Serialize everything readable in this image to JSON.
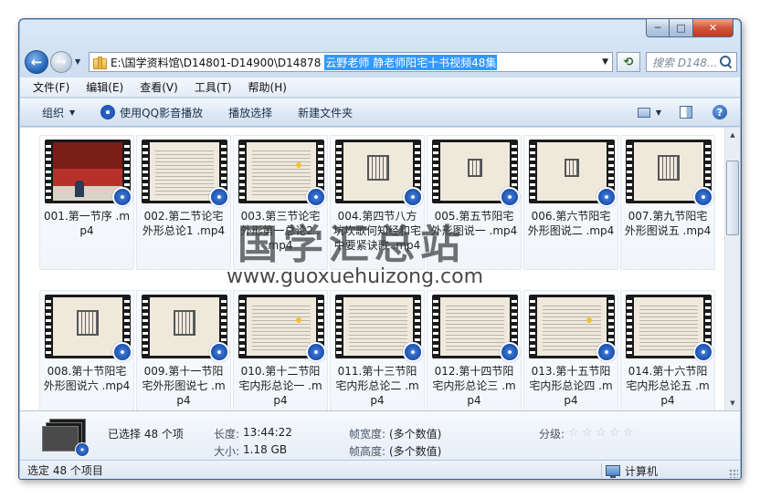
{
  "window": {
    "caption_buttons": {
      "minimize": "─",
      "maximize": "□",
      "close": "✕"
    }
  },
  "address": {
    "path_prefix": "E:\\国学资料馆\\D14801-D14900\\D14878",
    "path_selected": "云野老师 静老师阳宅十书视频48集",
    "search_placeholder": "搜索 D148..."
  },
  "menu": [
    "文件(F)",
    "编辑(E)",
    "查看(V)",
    "工具(T)",
    "帮助(H)"
  ],
  "toolbar": {
    "organize": "组织",
    "play_qq": "使用QQ影音播放",
    "play_selection": "播放选择",
    "new_folder": "新建文件夹"
  },
  "files": [
    {
      "label": "001.第一节序 .mp4",
      "thumb": "photo"
    },
    {
      "label": "002.第二节论宅外形总论1 .mp4",
      "thumb": "text"
    },
    {
      "label": "003.第三节论宅外形第一总论2 .mp4",
      "thumb": "text"
    },
    {
      "label": "004.第四节八方坑坎歌何知经和宅中要紧诀歌 .mp4",
      "thumb": "figure"
    },
    {
      "label": "005.第五节阳宅外形图说一 .mp4",
      "thumb": "figure"
    },
    {
      "label": "006.第六节阳宅外形图说二 .mp4",
      "thumb": "figure"
    },
    {
      "label": "007.第九节阳宅外形图说五 .mp4",
      "thumb": "figure"
    },
    {
      "label": "008.第十节阳宅外形图说六 .mp4",
      "thumb": "figure"
    },
    {
      "label": "009.第十一节阳宅外形图说七 .mp4",
      "thumb": "figure"
    },
    {
      "label": "010.第十二节阳宅内形总论一 .mp4",
      "thumb": "text"
    },
    {
      "label": "011.第十三节阳宅内形总论二 .mp4",
      "thumb": "text"
    },
    {
      "label": "012.第十四节阳宅内形总论三 .mp4",
      "thumb": "text"
    },
    {
      "label": "013.第十五节阳宅内形总论四 .mp4",
      "thumb": "text"
    },
    {
      "label": "014.第十六节阳宅内形总论五 .mp4",
      "thumb": "text"
    }
  ],
  "watermark": {
    "cn": "国学汇总站",
    "url": "www.guoxuehuizong.com"
  },
  "details": {
    "selected": "已选择 48 个项",
    "length_label": "长度:",
    "length_value": "13:44:22",
    "size_label": "大小:",
    "size_value": "1.18 GB",
    "frame_width_label": "帧宽度:",
    "frame_width_value": "(多个数值)",
    "frame_height_label": "帧高度:",
    "frame_height_value": "(多个数值)",
    "rating_label": "分级:",
    "rating_stars": 0
  },
  "status": {
    "left": "选定 48 个项目",
    "right": "计算机"
  }
}
